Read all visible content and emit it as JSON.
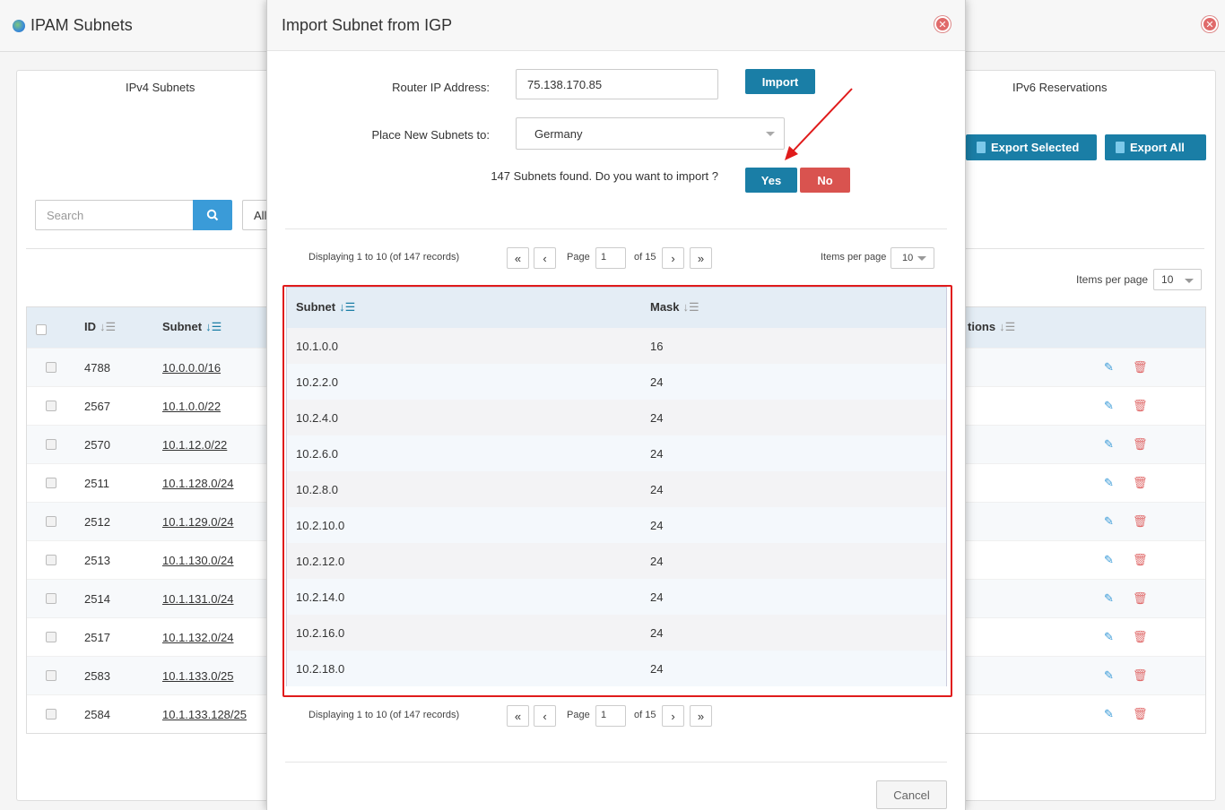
{
  "background": {
    "app_title": "IPAM Subnets",
    "tabs": {
      "ipv4": "IPv4 Subnets",
      "ipv6": "IPv6 Reservations"
    },
    "export_selected_label": "Export Selected",
    "export_all_label": "Export All",
    "search_placeholder": "Search",
    "filter_all": "All",
    "items_per_page_label": "Items per page",
    "items_per_page_value": "10",
    "table": {
      "headers": {
        "id": "ID",
        "subnet": "Subnet",
        "actions": "tions"
      },
      "rows": [
        {
          "id": "4788",
          "subnet": "10.0.0.0/16"
        },
        {
          "id": "2567",
          "subnet": "10.1.0.0/22"
        },
        {
          "id": "2570",
          "subnet": "10.1.12.0/22"
        },
        {
          "id": "2511",
          "subnet": "10.1.128.0/24"
        },
        {
          "id": "2512",
          "subnet": "10.1.129.0/24"
        },
        {
          "id": "2513",
          "subnet": "10.1.130.0/24"
        },
        {
          "id": "2514",
          "subnet": "10.1.131.0/24"
        },
        {
          "id": "2517",
          "subnet": "10.1.132.0/24"
        },
        {
          "id": "2583",
          "subnet": "10.1.133.0/25"
        },
        {
          "id": "2584",
          "subnet": "10.1.133.128/25"
        }
      ]
    }
  },
  "modal": {
    "title": "Import Subnet from IGP",
    "router_ip_label": "Router IP Address:",
    "router_ip_value": "75.138.170.85",
    "import_label": "Import",
    "place_label": "Place New Subnets to:",
    "place_value": "Germany",
    "found_text": "147 Subnets found. Do you want to import ?",
    "yes_label": "Yes",
    "no_label": "No",
    "pager": {
      "display_text": "Displaying 1 to 10 (of 147 records)",
      "first": "«",
      "prev": "‹",
      "next": "›",
      "last": "»",
      "page_label": "Page",
      "page_value": "1",
      "of_text": "of 15",
      "items_per_page_label": "Items per page",
      "items_per_page_value": "10"
    },
    "table": {
      "headers": {
        "subnet": "Subnet",
        "mask": "Mask"
      },
      "rows": [
        {
          "subnet": "10.1.0.0",
          "mask": "16"
        },
        {
          "subnet": "10.2.2.0",
          "mask": "24"
        },
        {
          "subnet": "10.2.4.0",
          "mask": "24"
        },
        {
          "subnet": "10.2.6.0",
          "mask": "24"
        },
        {
          "subnet": "10.2.8.0",
          "mask": "24"
        },
        {
          "subnet": "10.2.10.0",
          "mask": "24"
        },
        {
          "subnet": "10.2.12.0",
          "mask": "24"
        },
        {
          "subnet": "10.2.14.0",
          "mask": "24"
        },
        {
          "subnet": "10.2.16.0",
          "mask": "24"
        },
        {
          "subnet": "10.2.18.0",
          "mask": "24"
        }
      ]
    },
    "cancel_label": "Cancel"
  },
  "colors": {
    "primary": "#1a7ea6",
    "danger": "#d9534f",
    "highlight_outline": "#e01b1b",
    "table_header": "#e4edf5"
  },
  "icons": {
    "close": "close-icon",
    "search": "search-icon",
    "sort": "sort-icon",
    "edit": "edit-icon",
    "delete": "trash-icon",
    "export": "document-icon"
  }
}
